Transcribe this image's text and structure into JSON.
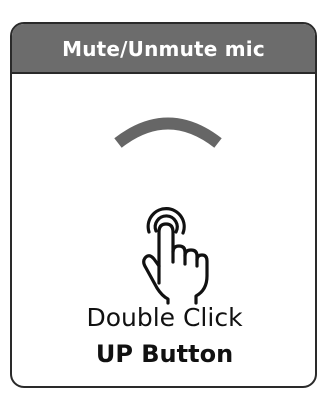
{
  "card": {
    "title": "Mute/Unmute mic",
    "icons": {
      "arc": "upper-arc-indicator-icon",
      "gesture": "hand-tap-icon"
    },
    "instruction": {
      "line1": "Double Click",
      "line2": "UP Button"
    }
  },
  "colors": {
    "header_background": "#6c6c6c",
    "header_text": "#ffffff",
    "border": "#2a2a2a",
    "arc": "#666666",
    "body_text": "#111111"
  }
}
